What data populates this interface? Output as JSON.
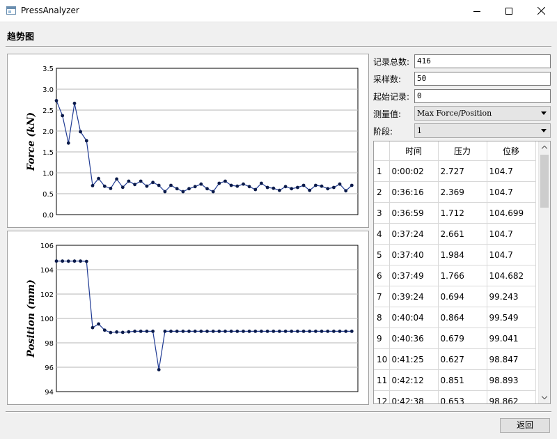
{
  "window": {
    "title": "PressAnalyzer"
  },
  "section_title": "趋势图",
  "fields": {
    "total_label": "记录总数:",
    "total_value": "416",
    "sample_label": "采样数:",
    "sample_value": "50",
    "start_label": "起始记录:",
    "start_value": "0",
    "measure_label": "测量值:",
    "measure_value": "Max Force/Position",
    "stage_label": "阶段:",
    "stage_value": "1"
  },
  "table": {
    "headers": [
      "",
      "时间",
      "压力",
      "位移"
    ],
    "rows": [
      [
        "1",
        "0:00:02",
        "2.727",
        "104.7"
      ],
      [
        "2",
        "0:36:16",
        "2.369",
        "104.7"
      ],
      [
        "3",
        "0:36:59",
        "1.712",
        "104.699"
      ],
      [
        "4",
        "0:37:24",
        "2.661",
        "104.7"
      ],
      [
        "5",
        "0:37:40",
        "1.984",
        "104.7"
      ],
      [
        "6",
        "0:37:49",
        "1.766",
        "104.682"
      ],
      [
        "7",
        "0:39:24",
        "0.694",
        "99.243"
      ],
      [
        "8",
        "0:40:04",
        "0.864",
        "99.549"
      ],
      [
        "9",
        "0:40:36",
        "0.679",
        "99.041"
      ],
      [
        "10",
        "0:41:25",
        "0.627",
        "98.847"
      ],
      [
        "11",
        "0:42:12",
        "0.851",
        "98.893"
      ],
      [
        "12",
        "0:42:38",
        "0.653",
        "98.862"
      ]
    ]
  },
  "buttons": {
    "back": "返回"
  },
  "chart_data": [
    {
      "type": "line",
      "ylabel": "Force (kN)",
      "ylim": [
        0,
        3.5
      ],
      "yticks": [
        "0.0",
        "0.5",
        "1.0",
        "1.5",
        "2.0",
        "2.5",
        "3.0",
        "3.5"
      ],
      "xlim": [
        0,
        50
      ],
      "grid": true,
      "color": "#1f3a93",
      "values": [
        2.727,
        2.369,
        1.712,
        2.661,
        1.984,
        1.766,
        0.694,
        0.864,
        0.679,
        0.627,
        0.851,
        0.653,
        0.8,
        0.72,
        0.8,
        0.68,
        0.77,
        0.7,
        0.55,
        0.7,
        0.62,
        0.55,
        0.62,
        0.67,
        0.73,
        0.62,
        0.55,
        0.75,
        0.8,
        0.7,
        0.68,
        0.73,
        0.67,
        0.6,
        0.75,
        0.65,
        0.63,
        0.58,
        0.67,
        0.62,
        0.65,
        0.7,
        0.58,
        0.7,
        0.68,
        0.62,
        0.65,
        0.73,
        0.57,
        0.7
      ]
    },
    {
      "type": "line",
      "ylabel": "Position (mm)",
      "ylim": [
        94,
        106
      ],
      "yticks": [
        "94",
        "96",
        "98",
        "100",
        "102",
        "104",
        "106"
      ],
      "xlim": [
        0,
        50
      ],
      "grid": true,
      "color": "#1f3a93",
      "values": [
        104.7,
        104.7,
        104.699,
        104.7,
        104.7,
        104.682,
        99.243,
        99.549,
        99.041,
        98.847,
        98.893,
        98.862,
        98.9,
        98.95,
        98.95,
        98.95,
        98.95,
        95.8,
        98.95,
        98.95,
        98.95,
        98.95,
        98.95,
        98.95,
        98.95,
        98.95,
        98.95,
        98.95,
        98.95,
        98.95,
        98.95,
        98.95,
        98.95,
        98.95,
        98.95,
        98.95,
        98.95,
        98.95,
        98.95,
        98.95,
        98.95,
        98.95,
        98.95,
        98.95,
        98.95,
        98.95,
        98.95,
        98.95,
        98.95,
        98.95
      ]
    }
  ]
}
